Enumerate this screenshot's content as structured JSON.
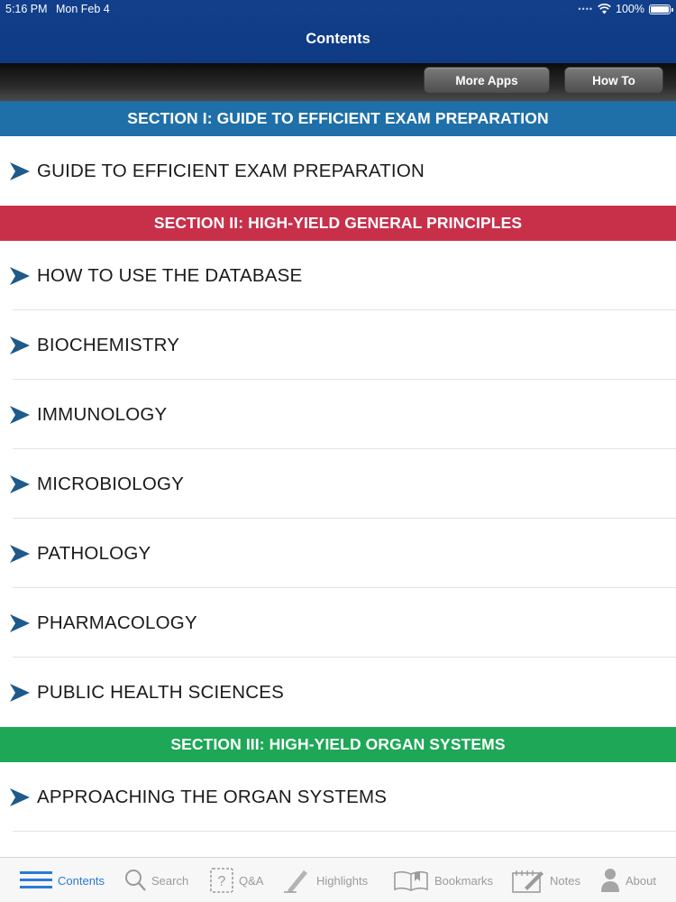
{
  "status_bar": {
    "time": "5:16 PM",
    "date": "Mon Feb 4",
    "battery": "100%"
  },
  "nav": {
    "title": "Contents"
  },
  "toolbar": {
    "more_apps": "More Apps",
    "how_to": "How To"
  },
  "colors": {
    "section1": "#1f6fa8",
    "section2": "#c8304a",
    "section3": "#1da756",
    "chevron": "#1e5a8a",
    "active_tab": "#2a7ad6"
  },
  "sections": [
    {
      "title": "SECTION I: GUIDE TO EFFICIENT EXAM PREPARATION",
      "items": [
        "GUIDE TO EFFICIENT EXAM PREPARATION"
      ]
    },
    {
      "title": "SECTION II: HIGH-YIELD GENERAL PRINCIPLES",
      "items": [
        "HOW TO USE THE DATABASE",
        "BIOCHEMISTRY",
        "IMMUNOLOGY",
        "MICROBIOLOGY",
        "PATHOLOGY",
        "PHARMACOLOGY",
        "PUBLIC HEALTH SCIENCES"
      ]
    },
    {
      "title": "SECTION III: HIGH-YIELD ORGAN SYSTEMS",
      "items": [
        "APPROACHING THE ORGAN SYSTEMS"
      ]
    }
  ],
  "tabs": [
    {
      "label": "Contents",
      "icon": "list-icon",
      "active": true
    },
    {
      "label": "Search",
      "icon": "search-icon",
      "active": false
    },
    {
      "label": "Q&A",
      "icon": "question-icon",
      "active": false
    },
    {
      "label": "Highlights",
      "icon": "highlighter-icon",
      "active": false
    },
    {
      "label": "Bookmarks",
      "icon": "book-icon",
      "active": false
    },
    {
      "label": "Notes",
      "icon": "notepad-icon",
      "active": false
    },
    {
      "label": "About",
      "icon": "person-icon",
      "active": false
    }
  ]
}
